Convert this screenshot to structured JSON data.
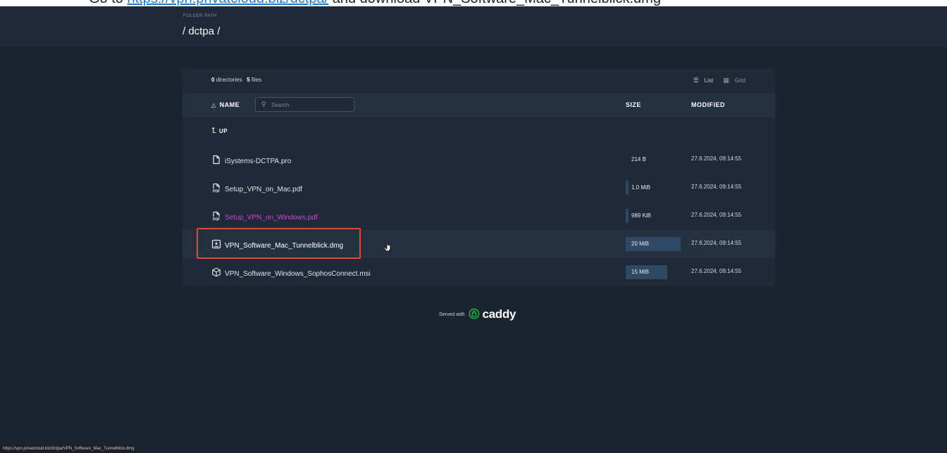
{
  "top_strip": {
    "prefix": "Go to ",
    "link_text": "https://vpn.privatcloud.biz/dctpa/",
    "suffix": " and download VPN_Software_Mac_Tunnelblick.dmg"
  },
  "header": {
    "folder_path_label": "FOLDER PATH",
    "path": "/ dctpa /"
  },
  "listing": {
    "dir_count": "0",
    "dir_label": "directories",
    "file_count": "5",
    "file_label": "files",
    "view_list": "List",
    "view_grid": "Grid",
    "columns": {
      "name": "NAME",
      "size": "SIZE",
      "modified": "MODIFIED"
    },
    "search_placeholder": "Search",
    "up_label": "UP",
    "rows": [
      {
        "name": "iSystems-DCTPA.pro",
        "icon": "file-icon",
        "size": "214 B",
        "size_fraction": 0.0,
        "modified": "27.6.2024, 09:14:55",
        "state": "normal"
      },
      {
        "name": "Setup_VPN_on_Mac.pdf",
        "icon": "pdf-icon",
        "size": "1.0 MiB",
        "size_fraction": 0.05,
        "modified": "27.6.2024, 09:14:55",
        "state": "normal"
      },
      {
        "name": "Setup_VPN_on_Windows.pdf",
        "icon": "pdf-icon",
        "size": "989 KiB",
        "size_fraction": 0.05,
        "modified": "27.6.2024, 09:14:55",
        "state": "visited"
      },
      {
        "name": "VPN_Software_Mac_Tunnelblick.dmg",
        "icon": "disk-image-icon",
        "size": "20 MiB",
        "size_fraction": 1.0,
        "modified": "27.6.2024, 09:14:55",
        "state": "hovered"
      },
      {
        "name": "VPN_Software_Windows_SophosConnect.msi",
        "icon": "package-icon",
        "size": "15 MiB",
        "size_fraction": 0.75,
        "modified": "27.6.2024, 09:14:55",
        "state": "normal"
      }
    ]
  },
  "footer": {
    "served_with": "Served with",
    "brand": "caddy"
  },
  "status_bar": {
    "url": "https://vpn.privatcloud.biz/dctpa/VPN_Software_Mac_Tunnelblick.dmg"
  },
  "colors": {
    "page_bg": "#1b2431",
    "card_bg": "#1f2937",
    "header_row_bg": "#253141",
    "size_bar": "#2f4863",
    "visited_link": "#c54ad2",
    "highlight_box": "#e04a3e"
  }
}
